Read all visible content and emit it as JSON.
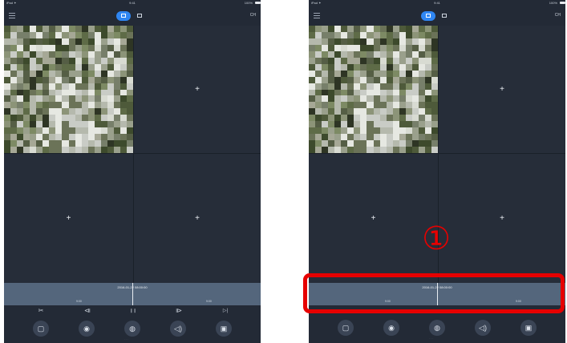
{
  "status_bar": {
    "left": "iPad ✦",
    "center": "9:41",
    "right": "100%"
  },
  "topbar": {
    "menu_icon": "menu-icon",
    "layout_options": [
      "grid-4-icon",
      "grid-1-icon"
    ],
    "right_label": "CH"
  },
  "grid": {
    "cells": [
      {
        "content": "video"
      },
      {
        "content": "add",
        "symbol": "+"
      },
      {
        "content": "add",
        "symbol": "+"
      },
      {
        "content": "add",
        "symbol": "+"
      }
    ]
  },
  "timeline": {
    "timestamp": "2016-01-22  08:00:00",
    "ticks": [
      "9:00",
      "9:00"
    ]
  },
  "playback_controls": [
    {
      "name": "cut",
      "glyph": "✂"
    },
    {
      "name": "prev-frame",
      "glyph": "⧏"
    },
    {
      "name": "pause",
      "glyph": "❙❙"
    },
    {
      "name": "next-frame",
      "glyph": "⧐"
    },
    {
      "name": "skip-end",
      "glyph": "▷|"
    }
  ],
  "action_buttons": [
    {
      "name": "record",
      "glyph": "▢"
    },
    {
      "name": "snapshot",
      "glyph": "◉"
    },
    {
      "name": "playback",
      "glyph": "◍"
    },
    {
      "name": "audio",
      "glyph": "◁)"
    },
    {
      "name": "gallery",
      "glyph": "▣"
    }
  ],
  "footer_hint": "· · ·",
  "annotation": {
    "number": "①",
    "color": "#e60000"
  },
  "colors": {
    "background": "#232a36",
    "timeline": "#54667c",
    "accent": "#2f86f2"
  }
}
